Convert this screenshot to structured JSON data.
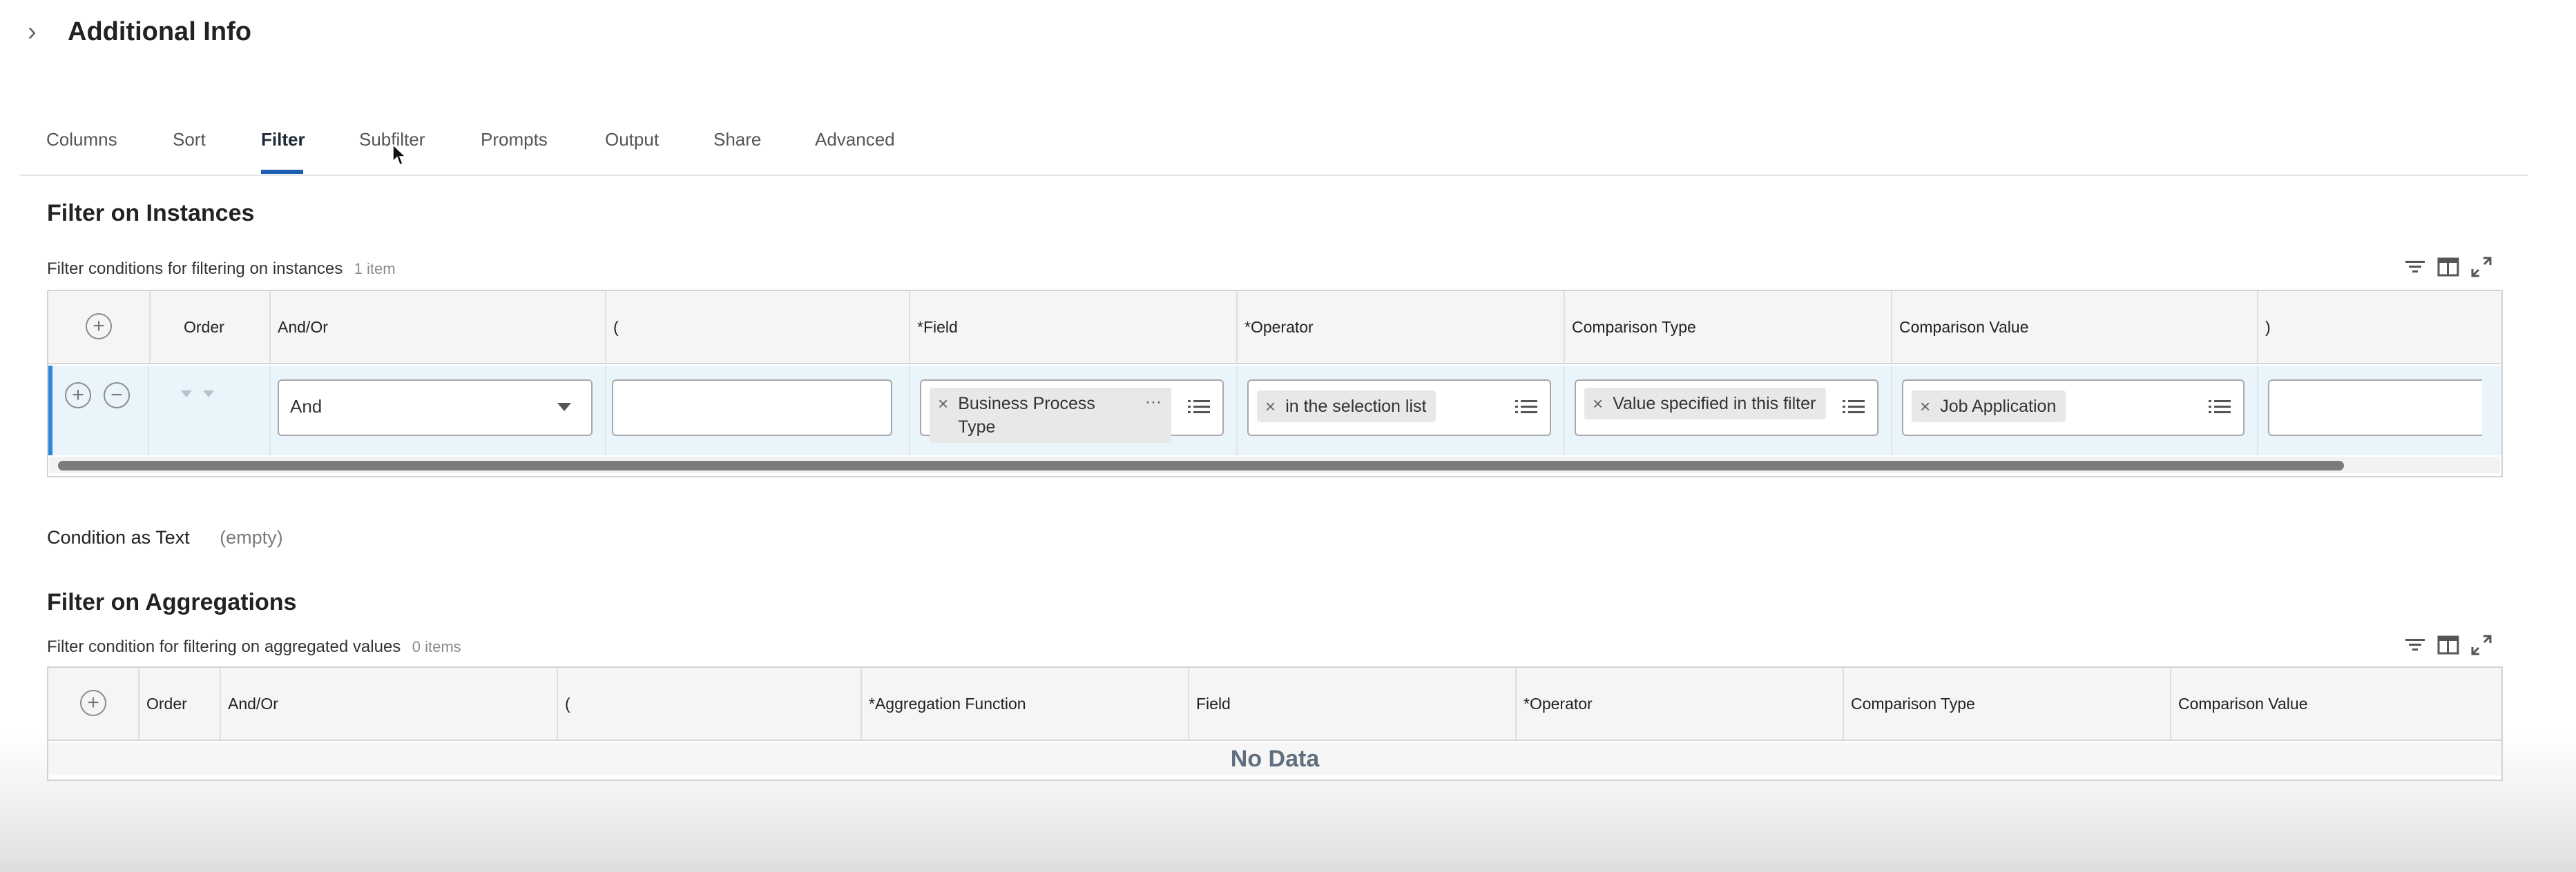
{
  "header": {
    "title": "Additional Info"
  },
  "tabs": [
    {
      "label": "Columns"
    },
    {
      "label": "Sort"
    },
    {
      "label": "Filter",
      "active": true
    },
    {
      "label": "Subfilter"
    },
    {
      "label": "Prompts"
    },
    {
      "label": "Output"
    },
    {
      "label": "Share"
    },
    {
      "label": "Advanced"
    }
  ],
  "instances": {
    "title": "Filter on Instances",
    "caption": "Filter conditions for filtering on instances",
    "count": "1 item",
    "columns": [
      "Order",
      "And/Or",
      "(",
      "*Field",
      "*Operator",
      "Comparison Type",
      "Comparison Value",
      ")"
    ],
    "row": {
      "and_or": "And",
      "open_paren": "",
      "field_chip": "Business Process Type",
      "operator_chip": "in the selection list",
      "comparison_type_chip": "Value specified in this filter",
      "comparison_value_chip": "Job Application",
      "close_paren": ""
    }
  },
  "condition_text": {
    "label": "Condition as Text",
    "value": "(empty)"
  },
  "aggregations": {
    "title": "Filter on Aggregations",
    "caption": "Filter condition for filtering on aggregated values",
    "count": "0 items",
    "columns": [
      "Order",
      "And/Or",
      "(",
      "*Aggregation Function",
      "Field",
      "*Operator",
      "Comparison Type",
      "Comparison Value"
    ],
    "empty_text": "No Data"
  },
  "colors": {
    "accent": "#1e5fb4",
    "row_highlight": "#eaf4fb",
    "row_indicator": "#2f86d9"
  }
}
